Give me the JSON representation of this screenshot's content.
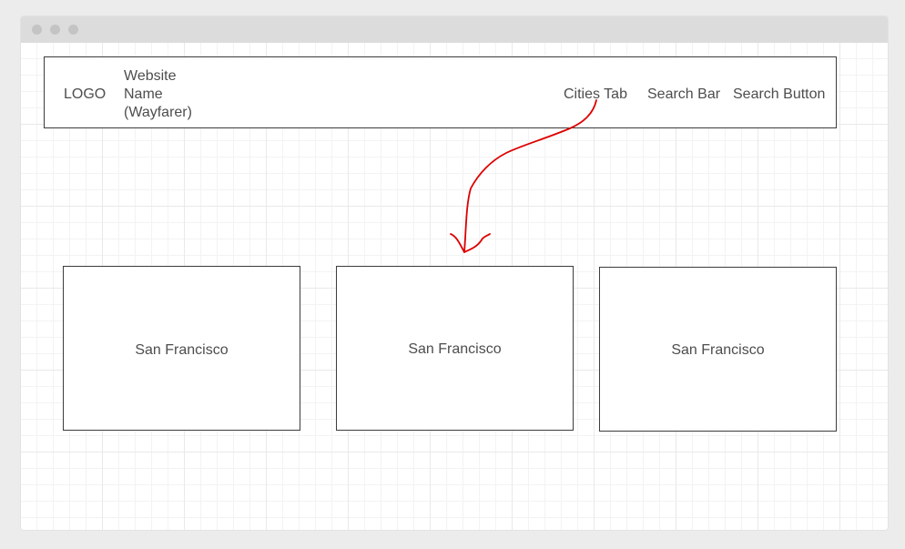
{
  "header": {
    "logo": "LOGO",
    "site_name_lines": [
      "Website",
      "Name",
      "(Wayfarer)"
    ],
    "cities_tab": "Cities Tab",
    "search_bar": "Search Bar",
    "search_button": "Search Button"
  },
  "cards": [
    {
      "label": "San Francisco"
    },
    {
      "label": "San Francisco"
    },
    {
      "label": "San Francisco"
    }
  ],
  "colors": {
    "arrow": "#dd0000",
    "box_border": "#3c3c3c",
    "text": "#4d4d4d"
  }
}
